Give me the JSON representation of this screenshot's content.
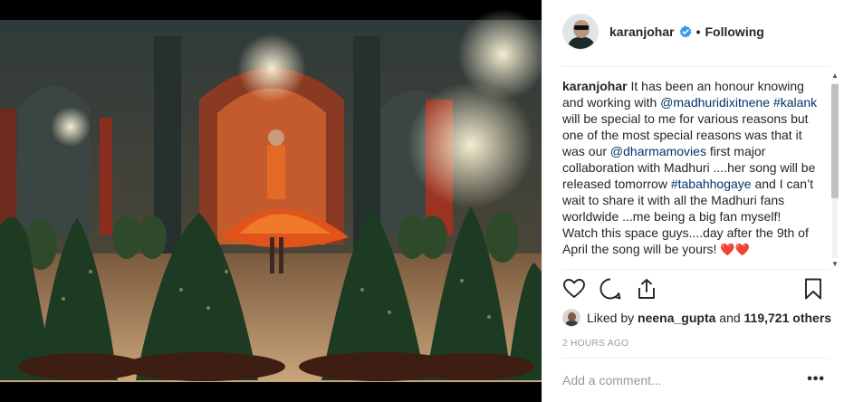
{
  "post": {
    "username": "karanjohar",
    "verified": true,
    "follow_separator": "•",
    "follow_status": "Following"
  },
  "caption": {
    "username": "karanjohar",
    "t1": " It has been an honour knowing and working with ",
    "mention1": "@madhuridixitnene",
    "t2": " ",
    "hashtag1": "#kalank",
    "t3": " will be special to me for various reasons but one of the most special reasons was that it was our ",
    "mention2": "@dharmamovies",
    "t4": " first major collaboration with Madhuri ....her song will be released tomorrow ",
    "hashtag2": "#tabahhogaye",
    "t5": " and I can’t wait to share it with all the Madhuri fans worldwide ...me being a big fan myself! Watch this space guys....day after the 9th of April the song will be yours! ",
    "emoji": "❤️❤️"
  },
  "actions": {
    "like_icon": "heart-outline-icon",
    "comment_icon": "speech-bubble-icon",
    "share_icon": "share-arrow-icon",
    "save_icon": "bookmark-outline-icon"
  },
  "likes": {
    "prefix": "Liked by ",
    "liker": "neena_gupta",
    "middle": " and ",
    "others": "119,721 others"
  },
  "timestamp": "2 HOURS AGO",
  "comment": {
    "placeholder": "Add a comment...",
    "more_label": "•••"
  },
  "colors": {
    "link": "#003569",
    "verified": "#3897f0",
    "text": "#262626",
    "muted": "#999999"
  }
}
